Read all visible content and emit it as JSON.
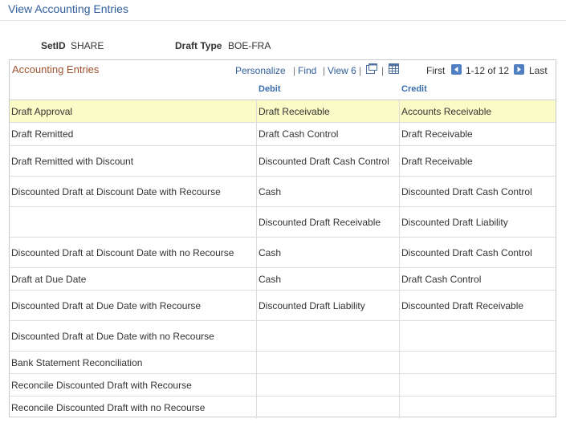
{
  "page": {
    "title": "View Accounting Entries"
  },
  "fields": {
    "setid_label": "SetID",
    "setid_value": "SHARE",
    "drafttype_label": "Draft Type",
    "drafttype_value": "BOE-FRA"
  },
  "grid": {
    "title": "Accounting Entries",
    "personalize": "Personalize",
    "find": "Find",
    "view": "View 6",
    "first": "First",
    "range": "1-12 of 12",
    "last": "Last",
    "icons": {
      "zoom": "new-window-icon",
      "download": "spreadsheet-icon",
      "prev": "arrow-left-icon",
      "next": "arrow-right-icon"
    },
    "columns": {
      "entry": "",
      "debit": "Debit",
      "credit": "Credit"
    },
    "rows": [
      {
        "entry": "Draft Approval",
        "debit": "Draft Receivable",
        "credit": "Accounts Receivable"
      },
      {
        "entry": "Draft Remitted",
        "debit": "Draft Cash Control",
        "credit": "Draft Receivable"
      },
      {
        "entry": "Draft Remitted with Discount",
        "debit": "Discounted Draft Cash Control",
        "credit": "Draft Receivable"
      },
      {
        "entry": "Discounted Draft at Discount Date with Recourse",
        "debit": "Cash",
        "credit": "Discounted Draft Cash Control"
      },
      {
        "entry": "",
        "debit": "Discounted Draft Receivable",
        "credit": "Discounted Draft Liability"
      },
      {
        "entry": "Discounted Draft at Discount Date with no Recourse",
        "debit": "Cash",
        "credit": "Discounted Draft Cash Control"
      },
      {
        "entry": "Draft at Due Date",
        "debit": "Cash",
        "credit": "Draft Cash Control"
      },
      {
        "entry": "Discounted Draft at Due Date with Recourse",
        "debit": "Discounted Draft Liability",
        "credit": "Discounted Draft Receivable"
      },
      {
        "entry": "Discounted Draft at Due Date with no Recourse",
        "debit": "",
        "credit": ""
      },
      {
        "entry": "Bank Statement Reconciliation",
        "debit": "",
        "credit": ""
      },
      {
        "entry": "Reconcile Discounted Draft with Recourse",
        "debit": "",
        "credit": ""
      },
      {
        "entry": "Reconcile Discounted Draft with no Recourse",
        "debit": "",
        "credit": ""
      }
    ]
  },
  "colors": {
    "link": "#2f5e9c",
    "title_accent": "#a0522d",
    "selected_row": "#fbfbc8"
  }
}
